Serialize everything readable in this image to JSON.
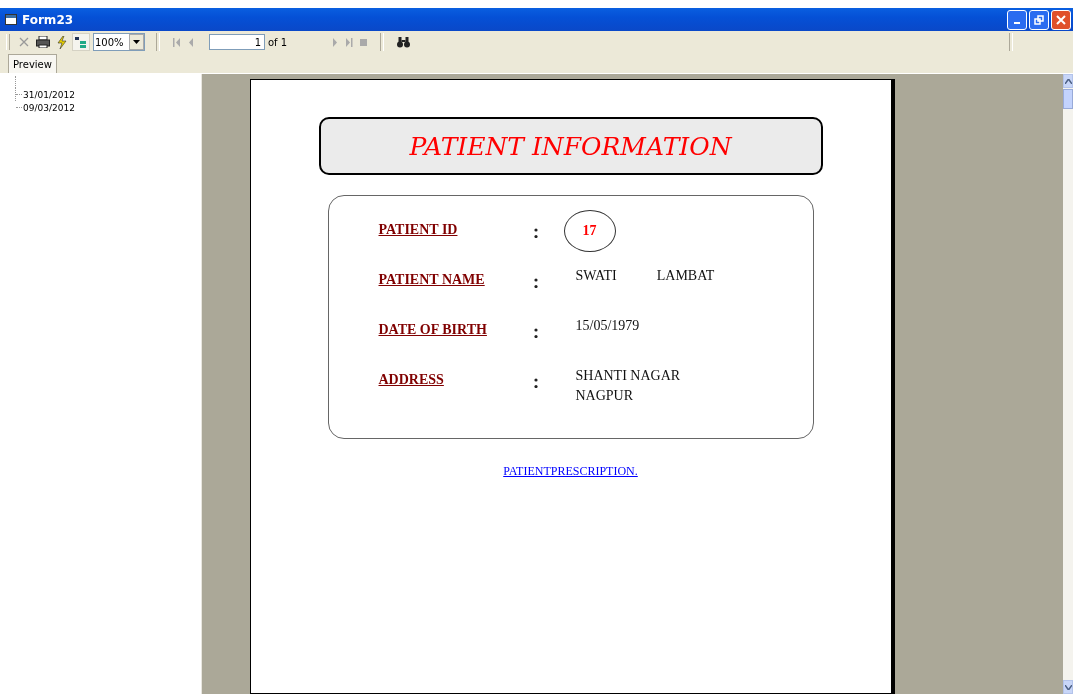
{
  "window": {
    "title": "Form23"
  },
  "toolbar": {
    "zoom": "100%",
    "page": "1",
    "page_count": "of 1"
  },
  "tabs": [
    {
      "label": "Preview",
      "selected": true
    }
  ],
  "tree": {
    "children": [
      {
        "label": "31/01/2012"
      },
      {
        "label": "09/03/2012"
      }
    ]
  },
  "report": {
    "title": "PATIENT INFORMATION",
    "fields": [
      {
        "label": "PATIENT ID",
        "kind": "circled",
        "values": [
          "17"
        ]
      },
      {
        "label": "PATIENT NAME",
        "kind": "text",
        "values": [
          "SWATI",
          "LAMBAT"
        ]
      },
      {
        "label": "DATE OF BIRTH",
        "kind": "text",
        "values": [
          "15/05/1979"
        ]
      },
      {
        "label": "ADDRESS",
        "kind": "lines",
        "values": [
          "SHANTI NAGAR",
          "NAGPUR"
        ]
      }
    ],
    "link": "PATIENTPRESCRIPTION."
  }
}
